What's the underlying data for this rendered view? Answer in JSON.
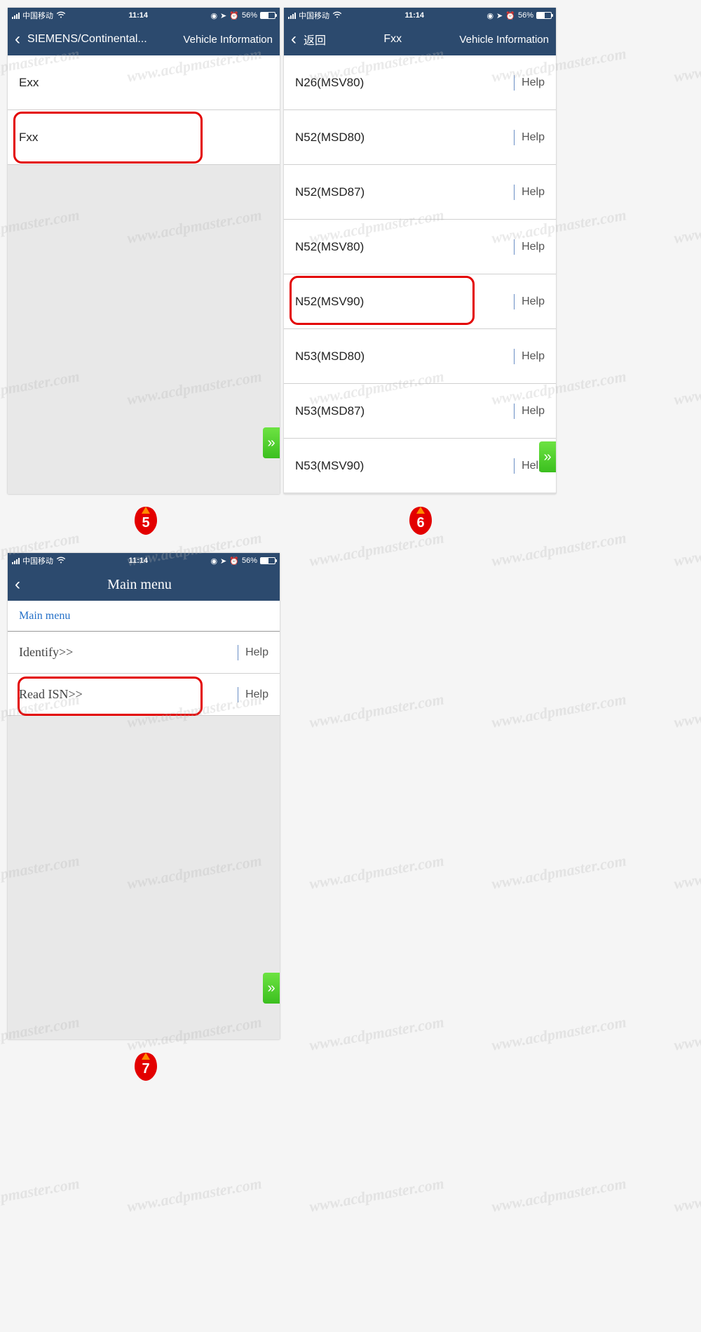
{
  "status": {
    "carrier": "中国移动",
    "time": "11:14",
    "battery_text": "56%"
  },
  "screen5": {
    "header_title": "SIEMENS/Continental...",
    "header_right": "Vehicle Information",
    "items": [
      {
        "label": "Exx"
      },
      {
        "label": "Fxx"
      }
    ],
    "step": "5"
  },
  "screen6": {
    "back_text": "返回",
    "header_title": "Fxx",
    "header_right": "Vehicle Information",
    "help_label": "Help",
    "items": [
      {
        "label": "N26(MSV80)"
      },
      {
        "label": "N52(MSD80)"
      },
      {
        "label": "N52(MSD87)"
      },
      {
        "label": "N52(MSV80)"
      },
      {
        "label": "N52(MSV90)"
      },
      {
        "label": "N53(MSD80)"
      },
      {
        "label": "N53(MSD87)"
      },
      {
        "label": "N53(MSV90)"
      }
    ],
    "step": "6"
  },
  "screen7": {
    "header_title": "Main menu",
    "sub_header": "Main menu",
    "help_label": "Help",
    "items": [
      {
        "label": "Identify>>"
      },
      {
        "label": "Read ISN>>"
      }
    ],
    "step": "7"
  },
  "watermark_text": "www.acdpmaster.com"
}
